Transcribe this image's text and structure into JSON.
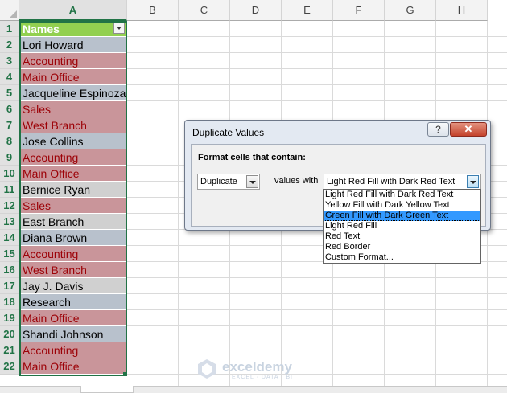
{
  "columns": [
    "A",
    "B",
    "C",
    "D",
    "E",
    "F",
    "G",
    "H"
  ],
  "rows": [
    "1",
    "2",
    "3",
    "4",
    "5",
    "6",
    "7",
    "8",
    "9",
    "10",
    "11",
    "12",
    "13",
    "14",
    "15",
    "16",
    "17",
    "18",
    "19",
    "20",
    "21",
    "22"
  ],
  "cells": [
    {
      "text": "Names",
      "style": "hdr"
    },
    {
      "text": "Lori Howard",
      "style": "plain"
    },
    {
      "text": "Accounting",
      "style": "dup"
    },
    {
      "text": "Main Office",
      "style": "dup"
    },
    {
      "text": "Jacqueline Espinoza",
      "style": "plain"
    },
    {
      "text": "Sales",
      "style": "dup"
    },
    {
      "text": "West Branch",
      "style": "dup"
    },
    {
      "text": "Jose Collins",
      "style": "plain"
    },
    {
      "text": "Accounting",
      "style": "dup"
    },
    {
      "text": "Main Office",
      "style": "dup"
    },
    {
      "text": "Bernice Ryan",
      "style": "gray"
    },
    {
      "text": "Sales",
      "style": "dup"
    },
    {
      "text": "East Branch",
      "style": "gray"
    },
    {
      "text": "Diana Brown",
      "style": "plain"
    },
    {
      "text": "Accounting",
      "style": "dup"
    },
    {
      "text": "West Branch",
      "style": "dup"
    },
    {
      "text": "Jay J. Davis",
      "style": "gray"
    },
    {
      "text": "Research",
      "style": "plain"
    },
    {
      "text": "Main Office",
      "style": "dup"
    },
    {
      "text": "Shandi Johnson",
      "style": "plain"
    },
    {
      "text": "Accounting",
      "style": "dup"
    },
    {
      "text": "Main Office",
      "style": "dup"
    }
  ],
  "dialog": {
    "title": "Duplicate Values",
    "help_label": "?",
    "close_label": "✕",
    "group_label": "Format cells that contain:",
    "type_value": "Duplicate",
    "values_with_label": "values with",
    "format_value": "Light Red Fill with Dark Red Text",
    "format_options": [
      "Light Red Fill with Dark Red Text",
      "Yellow Fill with Dark Yellow Text",
      "Green Fill with Dark Green Text",
      "Light Red Fill",
      "Red Text",
      "Red Border",
      "Custom Format..."
    ],
    "highlighted_option": 2
  },
  "watermark": {
    "name": "exceldemy",
    "tagline": "EXCEL · DATA · BI"
  },
  "colors": {
    "accent": "#217346",
    "duplicate_fill": "#c9959a",
    "duplicate_text": "#9c0006",
    "header_fill": "#92d050",
    "highlight": "#3399ff"
  }
}
